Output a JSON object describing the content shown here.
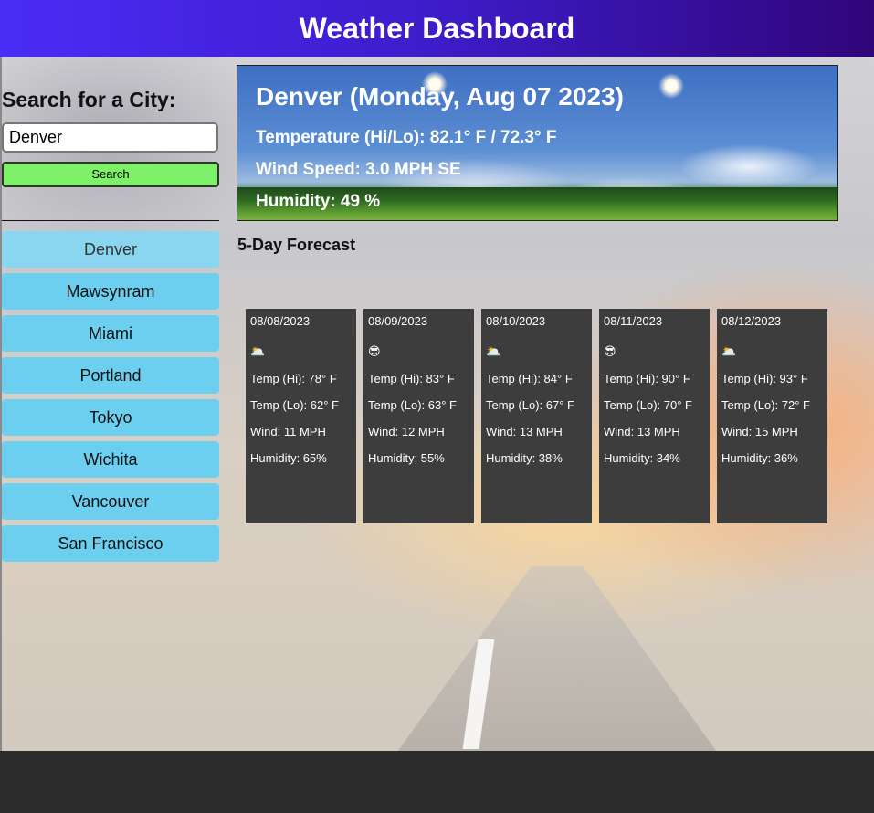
{
  "header": {
    "title": "Weather Dashboard"
  },
  "search": {
    "heading": "Search for a City:",
    "input_value": "Denver",
    "button_label": "Search"
  },
  "history": [
    {
      "label": "Denver"
    },
    {
      "label": "Mawsynram"
    },
    {
      "label": "Miami"
    },
    {
      "label": "Portland"
    },
    {
      "label": "Tokyo"
    },
    {
      "label": "Wichita"
    },
    {
      "label": "Vancouver"
    },
    {
      "label": "San Francisco"
    }
  ],
  "today": {
    "title": "Denver (Monday, Aug 07 2023)",
    "temperature": "Temperature (Hi/Lo): 82.1° F / 72.3° F",
    "wind": "Wind Speed: 3.0 MPH SE",
    "humidity": "Humidity: 49 %"
  },
  "forecast": {
    "heading": "5-Day Forecast",
    "days": [
      {
        "date": "08/08/2023",
        "icon": "🌥️",
        "icon_name": "partly-cloudy-icon",
        "temp_hi": "Temp (Hi): 78° F",
        "temp_lo": "Temp (Lo): 62° F",
        "wind": "Wind: 11 MPH",
        "humidity": "Humidity: 65%"
      },
      {
        "date": "08/09/2023",
        "icon": "😎",
        "icon_name": "sunglasses-icon",
        "temp_hi": "Temp (Hi): 83° F",
        "temp_lo": "Temp (Lo): 63° F",
        "wind": "Wind: 12 MPH",
        "humidity": "Humidity: 55%"
      },
      {
        "date": "08/10/2023",
        "icon": "🌥️",
        "icon_name": "partly-cloudy-icon",
        "temp_hi": "Temp (Hi): 84° F",
        "temp_lo": "Temp (Lo): 67° F",
        "wind": "Wind: 13 MPH",
        "humidity": "Humidity: 38%"
      },
      {
        "date": "08/11/2023",
        "icon": "😎",
        "icon_name": "sunglasses-icon",
        "temp_hi": "Temp (Hi): 90° F",
        "temp_lo": "Temp (Lo): 70° F",
        "wind": "Wind: 13 MPH",
        "humidity": "Humidity: 34%"
      },
      {
        "date": "08/12/2023",
        "icon": "🌥️",
        "icon_name": "partly-cloudy-icon",
        "temp_hi": "Temp (Hi): 93° F",
        "temp_lo": "Temp (Lo): 72° F",
        "wind": "Wind: 15 MPH",
        "humidity": "Humidity: 36%"
      }
    ]
  },
  "colors": {
    "header_start": "#4b2cf5",
    "header_end": "#30057a",
    "search_button": "#7ff06a",
    "city_button": "#6ccff0",
    "card_bg": "#3d3d3d",
    "footer_bg": "#2b2b2b"
  }
}
